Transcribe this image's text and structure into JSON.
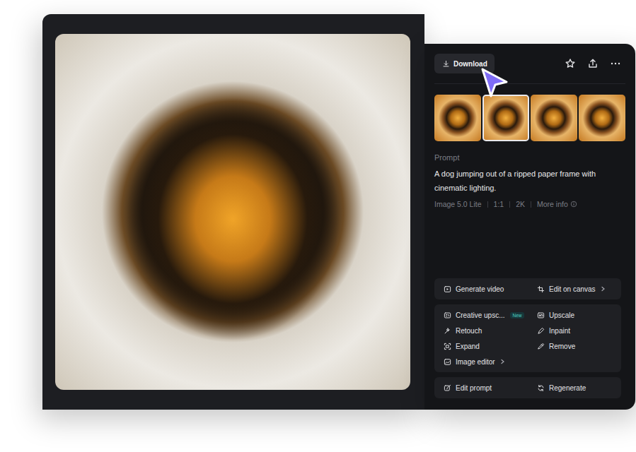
{
  "toolbar": {
    "download": "Download"
  },
  "photo": {},
  "thumbnails": [
    {
      "selected": false
    },
    {
      "selected": true
    },
    {
      "selected": false
    },
    {
      "selected": false
    }
  ],
  "prompt": {
    "label": "Prompt",
    "text": "A dog jumping out of a ripped paper frame with cinematic lighting."
  },
  "meta": [
    "Image 5.0 Lite",
    "1:1",
    "2K",
    "More info"
  ],
  "action_groups": [
    [
      {
        "label": "Generate video",
        "submenu": false
      },
      {
        "label": "Edit on canvas",
        "submenu": true
      }
    ],
    [
      {
        "label": "Creative upsc...",
        "badge": "New",
        "submenu": false
      },
      {
        "label": "Upscale",
        "submenu": false
      },
      {
        "label": "Retouch",
        "submenu": false
      },
      {
        "label": "Inpaint",
        "submenu": false
      },
      {
        "label": "Expand",
        "submenu": false
      },
      {
        "label": "Remove",
        "submenu": false
      },
      {
        "label": "Image editor",
        "submenu": true
      }
    ],
    [
      {
        "label": "Edit prompt",
        "submenu": false
      },
      {
        "label": "Regenerate",
        "submenu": false
      }
    ]
  ]
}
